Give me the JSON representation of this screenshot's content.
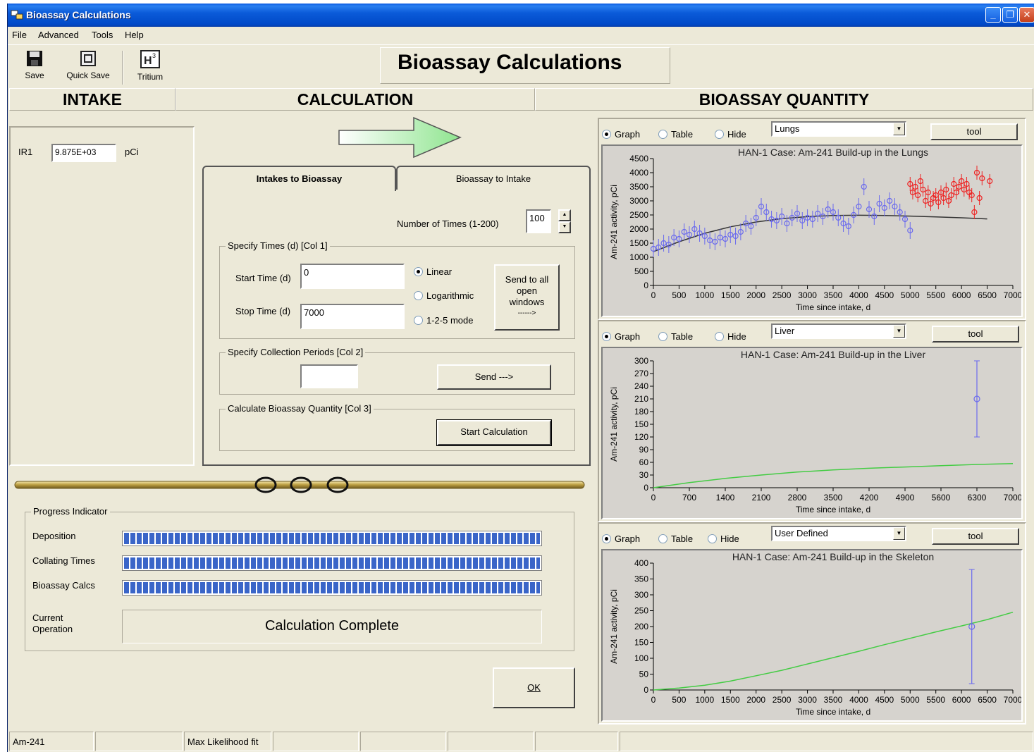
{
  "window": {
    "title": "Bioassay Calculations",
    "minimize": "_",
    "restore": "❐",
    "close": "✕"
  },
  "menu": [
    "File",
    "Advanced",
    "Tools",
    "Help"
  ],
  "toolbar": {
    "save": "Save",
    "quick_save": "Quick Save",
    "tritium": "Tritium"
  },
  "header_title": "Bioassay Calculations",
  "sections": {
    "intake": "INTAKE",
    "calculation": "CALCULATION",
    "bioassay": "BIOASSAY QUANTITY"
  },
  "intake": {
    "label": "IR1",
    "value": "9.875E+03",
    "unit": "pCi"
  },
  "tabs": {
    "active": "Intakes to Bioassay",
    "inactive": "Bioassay to Intake"
  },
  "calc": {
    "num_times_label": "Number of Times (1-200)",
    "num_times_value": "100",
    "specify_times_label": "Specify Times (d) [Col 1]",
    "start_time_label": "Start Time (d)",
    "start_time_value": "0",
    "stop_time_label": "Stop Time (d)",
    "stop_time_value": "7000",
    "scale_options": [
      "Linear",
      "Logarithmic",
      "1-2-5 mode"
    ],
    "scale_selected": "Linear",
    "send_all_line1": "Send to all",
    "send_all_line2": "open",
    "send_all_line3": "windows",
    "send_all_line4": "------>",
    "collection_label": "Specify Collection Periods [Col 2]",
    "collection_value": "",
    "send_button": "Send --->",
    "calc_label": "Calculate Bioassay Quantity [Col 3]",
    "start_button": "Start Calculation"
  },
  "progress": {
    "label": "Progress Indicator",
    "rows": [
      {
        "label": "Deposition",
        "value": 1.0
      },
      {
        "label": "Collating Times",
        "value": 1.0
      },
      {
        "label": "Bioassay Calcs",
        "value": 1.0
      }
    ],
    "current_label_1": "Current",
    "current_label_2": "Operation",
    "current_value": "Calculation Complete"
  },
  "ok_button": "OK",
  "status": [
    "Am-241",
    "",
    "Max Likelihood fit",
    "",
    "",
    "",
    "",
    ""
  ],
  "view_options": [
    "Graph",
    "Table",
    "Hide"
  ],
  "tool_button": "tool",
  "colors": {
    "fit_lungs": "#333333",
    "fit_green": "#44cc44",
    "blue": "#6a6aee",
    "red": "#ee2222"
  },
  "chart_data": [
    {
      "type": "scatter",
      "dropdown": "Lungs",
      "title": "HAN-1 Case:  Am-241 Build-up in the Lungs",
      "xlabel": "Time since intake, d",
      "ylabel": "Am-241 activity, pCi",
      "xlim": [
        0,
        7000
      ],
      "ylim": [
        0,
        4500
      ],
      "xticks": [
        0,
        500,
        1000,
        1500,
        2000,
        2500,
        3000,
        3500,
        4000,
        4500,
        5000,
        5500,
        6000,
        6500,
        7000
      ],
      "yticks": [
        0,
        500,
        1000,
        1500,
        2000,
        2500,
        3000,
        3500,
        4000,
        4500
      ],
      "fit": {
        "x": [
          0,
          500,
          1000,
          1500,
          2000,
          2500,
          3000,
          3500,
          4000,
          4500,
          5000,
          5500,
          6000,
          6500
        ],
        "y": [
          1200,
          1550,
          1850,
          2080,
          2250,
          2370,
          2440,
          2480,
          2490,
          2480,
          2460,
          2430,
          2400,
          2360
        ]
      },
      "series": [
        {
          "color": "blue",
          "x": [
            0,
            100,
            200,
            300,
            400,
            500,
            600,
            700,
            800,
            900,
            1000,
            1100,
            1200,
            1300,
            1400,
            1500,
            1600,
            1700,
            1800,
            1900,
            2000,
            2100,
            2200,
            2300,
            2400,
            2500,
            2600,
            2700,
            2800,
            2900,
            3000,
            3100,
            3200,
            3300,
            3400,
            3500,
            3600,
            3700,
            3800,
            3900,
            4000,
            4100,
            4200,
            4300,
            4400,
            4500,
            4600,
            4700,
            4800,
            4900,
            5000
          ],
          "y": [
            1300,
            1350,
            1500,
            1450,
            1700,
            1650,
            1900,
            1800,
            2000,
            1850,
            1750,
            1600,
            1550,
            1700,
            1650,
            1800,
            1750,
            1900,
            2200,
            2100,
            2400,
            2800,
            2600,
            2350,
            2300,
            2450,
            2200,
            2400,
            2550,
            2300,
            2400,
            2350,
            2550,
            2450,
            2700,
            2600,
            2400,
            2200,
            2100,
            2500,
            2800,
            3500,
            2700,
            2450,
            2900,
            2750,
            3000,
            2800,
            2600,
            2350,
            1950
          ],
          "err": 300
        },
        {
          "color": "red",
          "x": [
            5000,
            5050,
            5100,
            5150,
            5200,
            5250,
            5300,
            5350,
            5400,
            5450,
            5500,
            5550,
            5600,
            5650,
            5700,
            5750,
            5800,
            5850,
            5900,
            5950,
            6000,
            6050,
            6100,
            6150,
            6200,
            6250,
            6300,
            6350,
            6400,
            6550
          ],
          "y": [
            3600,
            3300,
            3500,
            3200,
            3700,
            3400,
            3000,
            3300,
            2900,
            3100,
            3200,
            2950,
            3300,
            3100,
            3400,
            3000,
            3200,
            3600,
            3300,
            3500,
            3700,
            3400,
            3600,
            3300,
            3200,
            2600,
            4000,
            3100,
            3800,
            3700
          ],
          "err": 250
        }
      ]
    },
    {
      "type": "line",
      "dropdown": "Liver",
      "title": "HAN-1 Case: Am-241 Build-up in the Liver",
      "xlabel": "Time since intake, d",
      "ylabel": "Am-241 activity, pCi",
      "xlim": [
        0,
        7000
      ],
      "ylim": [
        0,
        300
      ],
      "xticks": [
        0,
        700,
        1400,
        2100,
        2800,
        3500,
        4200,
        4900,
        5600,
        6300,
        7000
      ],
      "yticks": [
        0,
        30,
        60,
        90,
        120,
        150,
        180,
        210,
        240,
        270,
        300
      ],
      "fit": {
        "x": [
          0,
          700,
          1400,
          2100,
          2800,
          3500,
          4200,
          4900,
          5600,
          6300,
          7000
        ],
        "y": [
          0,
          12,
          22,
          30,
          37,
          42,
          46,
          49,
          52,
          55,
          57
        ]
      },
      "points": [
        {
          "x": 6300,
          "y": 210,
          "lo": 120,
          "hi": 300
        }
      ]
    },
    {
      "type": "line",
      "dropdown": "User Defined",
      "title": "HAN-1 Case:  Am-241 Build-up in the Skeleton",
      "xlabel": "Time since intake, d",
      "ylabel": "Am-241 activity, pCi",
      "xlim": [
        0,
        7000
      ],
      "ylim": [
        0,
        400
      ],
      "xticks": [
        0,
        500,
        1000,
        1500,
        2000,
        2500,
        3000,
        3500,
        4000,
        4500,
        5000,
        5500,
        6000,
        6500,
        7000
      ],
      "yticks": [
        0,
        50,
        100,
        150,
        200,
        250,
        300,
        350,
        400
      ],
      "fit": {
        "x": [
          0,
          500,
          1000,
          1500,
          2000,
          2500,
          3000,
          3500,
          4000,
          4500,
          5000,
          5500,
          6000,
          6500,
          7000
        ],
        "y": [
          0,
          6,
          15,
          28,
          45,
          62,
          82,
          102,
          122,
          143,
          163,
          183,
          202,
          222,
          245
        ]
      },
      "points": [
        {
          "x": 6200,
          "y": 200,
          "lo": 20,
          "hi": 380
        }
      ]
    }
  ]
}
